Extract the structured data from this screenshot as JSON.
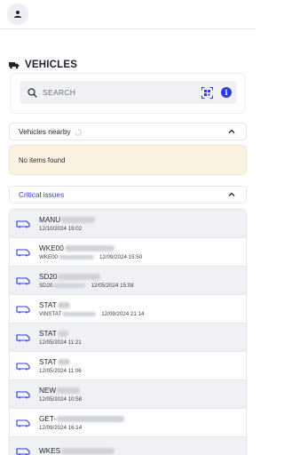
{
  "header": {
    "avatar_icon": "person-icon"
  },
  "page": {
    "title": "VEHICLES",
    "title_icon": "truck-icon"
  },
  "search": {
    "placeholder": "SEARCH",
    "icons": [
      "search-icon",
      "qr-scan-icon",
      "info-icon"
    ]
  },
  "nearby": {
    "label": "Vehicles nearby",
    "empty_text": "No items found"
  },
  "critical": {
    "label": "Critical issues"
  },
  "colors": {
    "accent": "#2f3ad8",
    "warning_bg": "#fdf1e2",
    "row_alt": "#eff1f4"
  },
  "vehicles": [
    {
      "name": "MANU",
      "sub": "",
      "date": "12/10/2024 19:02"
    },
    {
      "name": "WKE00",
      "sub": "WKE00",
      "date": "12/09/2024 15:50"
    },
    {
      "name": "SD20",
      "sub": "SD20",
      "date": "12/05/2024 15:08"
    },
    {
      "name": "STAT",
      "sub": "VINSTAT",
      "date": "12/09/2024 21:14"
    },
    {
      "name": "STAT",
      "sub": "",
      "date": "12/05/2024 11:21"
    },
    {
      "name": "STAT",
      "sub": "",
      "date": "12/05/2024 11:06"
    },
    {
      "name": "NEW",
      "sub": "",
      "date": "12/05/2024 10:58"
    },
    {
      "name": "GET-",
      "sub": "",
      "date": "12/09/2024 16:14"
    },
    {
      "name": "WKES",
      "sub": "",
      "date": ""
    }
  ]
}
